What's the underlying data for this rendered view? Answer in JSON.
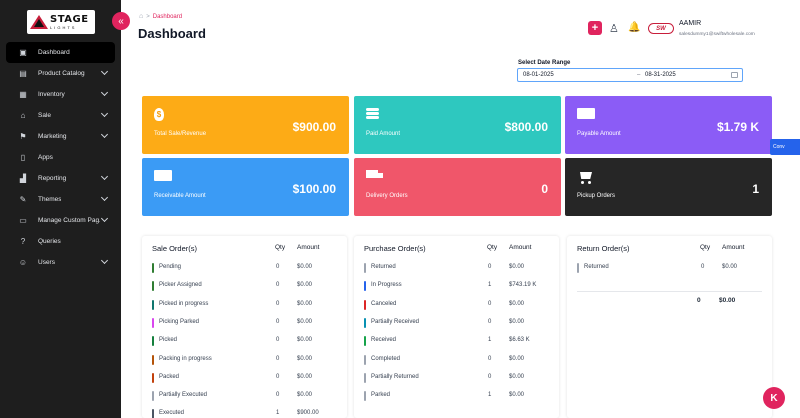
{
  "brand": {
    "logo_main": "STAGE",
    "logo_sub": "LIGHTS"
  },
  "sidebar": {
    "collapse_glyph": "«",
    "items": [
      {
        "label": "Dashboard",
        "icon": "grid-icon",
        "glyph": "▣",
        "chevron": false,
        "active": true
      },
      {
        "label": "Product Catalog",
        "icon": "catalog-icon",
        "glyph": "▤",
        "chevron": true
      },
      {
        "label": "Inventory",
        "icon": "inventory-icon",
        "glyph": "▦",
        "chevron": true
      },
      {
        "label": "Sale",
        "icon": "sale-icon",
        "glyph": "⌂",
        "chevron": true
      },
      {
        "label": "Marketing",
        "icon": "marketing-icon",
        "glyph": "⚑",
        "chevron": true
      },
      {
        "label": "Apps",
        "icon": "apps-icon",
        "glyph": "▯",
        "chevron": false
      },
      {
        "label": "Reporting",
        "icon": "chart-icon",
        "glyph": "▟",
        "chevron": true
      },
      {
        "label": "Themes",
        "icon": "brush-icon",
        "glyph": "✎",
        "chevron": true
      },
      {
        "label": "Manage Custom Pag...",
        "icon": "page-icon",
        "glyph": "▭",
        "chevron": true
      },
      {
        "label": "Queries",
        "icon": "question-icon",
        "glyph": "?",
        "chevron": false
      },
      {
        "label": "Users",
        "icon": "users-icon",
        "glyph": "☺",
        "chevron": true
      }
    ]
  },
  "breadcrumb": {
    "home_glyph": "⌂",
    "separator": ">",
    "current": "Dashboard"
  },
  "page": {
    "title": "Dashboard"
  },
  "header": {
    "add_glyph": "+",
    "user_glyph": "♙",
    "bell_glyph": "🔔",
    "brand_badge": "SW",
    "user_name": "AAMIR",
    "user_email": "salesdummy1@swiftwholesale.com"
  },
  "date_range": {
    "label": "Select Date Range",
    "start": "08-01-2025",
    "separator": "–",
    "end": "08-31-2025"
  },
  "cards": [
    {
      "label": "Total Sale/Revenue",
      "value": "$900.00",
      "color": "#fdab16",
      "icon": "money-bag-icon"
    },
    {
      "label": "Paid Amount",
      "value": "$800.00",
      "color": "#2ec8bf",
      "icon": "coins-icon"
    },
    {
      "label": "Payable Amount",
      "value": "$1.79 K",
      "color": "#8b5cf6",
      "icon": "bill-icon"
    },
    {
      "label": "Receivable Amount",
      "value": "$100.00",
      "color": "#3b9bf5",
      "icon": "cash-icon"
    },
    {
      "label": "Delivery Orders",
      "value": "0",
      "color": "#f0566a",
      "icon": "truck-icon"
    },
    {
      "label": "Pickup Orders",
      "value": "1",
      "color": "#262626",
      "icon": "cart-icon"
    }
  ],
  "sale_orders": {
    "title": "Sale Order(s)",
    "qty_header": "Qty",
    "amount_header": "Amount",
    "rows": [
      {
        "label": "Pending",
        "qty": "0",
        "amount": "$0.00",
        "color": "#2f7d32"
      },
      {
        "label": "Picker Assigned",
        "qty": "0",
        "amount": "$0.00",
        "color": "#2f7d32"
      },
      {
        "label": "Picked in progress",
        "qty": "0",
        "amount": "$0.00",
        "color": "#0f766e"
      },
      {
        "label": "Picking Parked",
        "qty": "0",
        "amount": "$0.00",
        "color": "#d946ef"
      },
      {
        "label": "Picked",
        "qty": "0",
        "amount": "$0.00",
        "color": "#15803d"
      },
      {
        "label": "Packing in progress",
        "qty": "0",
        "amount": "$0.00",
        "color": "#b45309"
      },
      {
        "label": "Packed",
        "qty": "0",
        "amount": "$0.00",
        "color": "#c2410c"
      },
      {
        "label": "Partially Executed",
        "qty": "0",
        "amount": "$0.00",
        "color": "#9ca3af"
      },
      {
        "label": "Executed",
        "qty": "1",
        "amount": "$900.00",
        "color": "#4b5563"
      }
    ]
  },
  "purchase_orders": {
    "title": "Purchase Order(s)",
    "qty_header": "Qty",
    "amount_header": "Amount",
    "rows": [
      {
        "label": "Returned",
        "qty": "0",
        "amount": "$0.00",
        "color": "#9ca3af"
      },
      {
        "label": "In Progress",
        "qty": "1",
        "amount": "$743.19 K",
        "color": "#2563eb"
      },
      {
        "label": "Canceled",
        "qty": "0",
        "amount": "$0.00",
        "color": "#dc2626"
      },
      {
        "label": "Partially Received",
        "qty": "0",
        "amount": "$0.00",
        "color": "#0891b2"
      },
      {
        "label": "Received",
        "qty": "1",
        "amount": "$6.63 K",
        "color": "#16a34a"
      },
      {
        "label": "Completed",
        "qty": "0",
        "amount": "$0.00",
        "color": "#9ca3af"
      },
      {
        "label": "Partially Returned",
        "qty": "0",
        "amount": "$0.00",
        "color": "#9ca3af"
      },
      {
        "label": "Parked",
        "qty": "1",
        "amount": "$0.00",
        "color": "#9ca3af"
      }
    ]
  },
  "return_orders": {
    "title": "Return Order(s)",
    "qty_header": "Qty",
    "amount_header": "Amount",
    "rows": [
      {
        "label": "Returned",
        "qty": "0",
        "amount": "$0.00",
        "color": "#9ca3af"
      }
    ],
    "total_qty": "0",
    "total_amount": "$0.00"
  },
  "widgets": {
    "convo_label": "Conv",
    "chat_letter": "K"
  }
}
